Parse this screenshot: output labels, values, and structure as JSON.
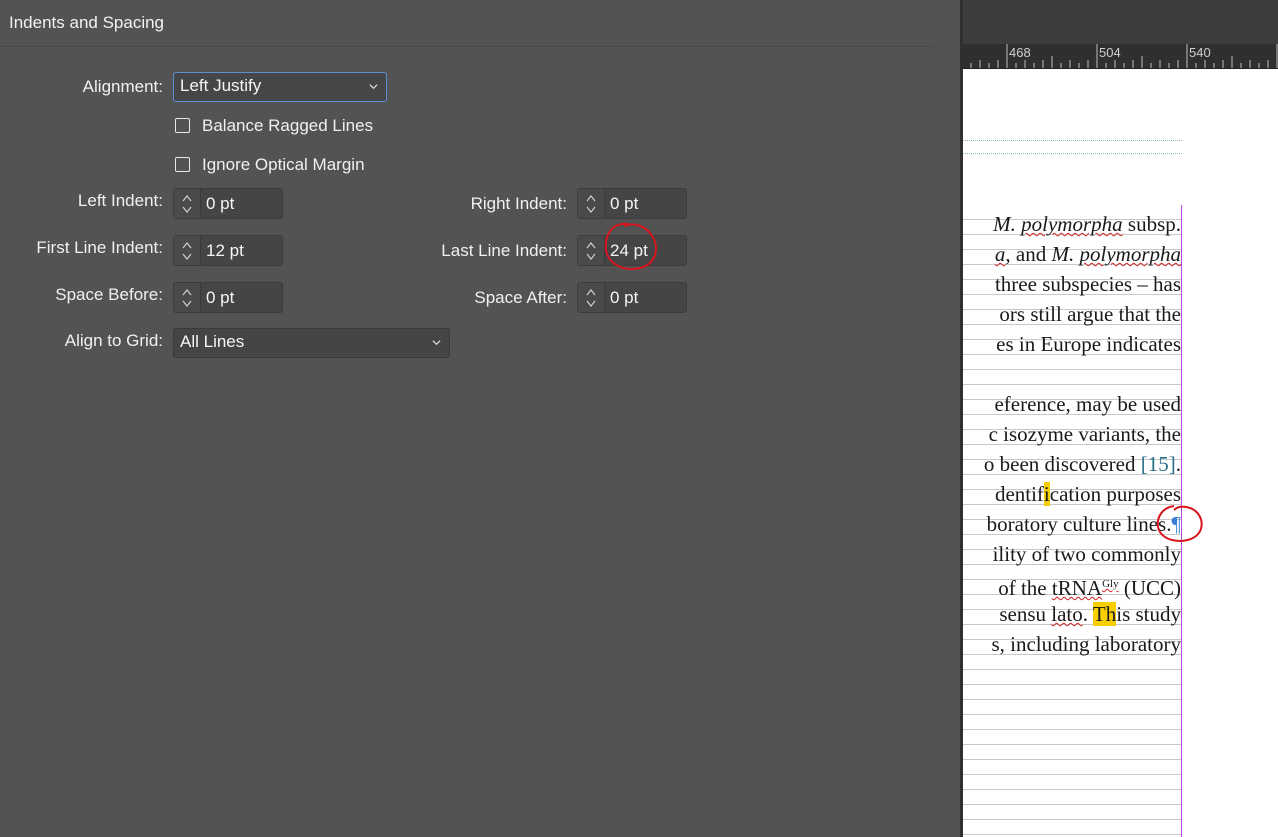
{
  "panel": {
    "title": "Indents and Spacing",
    "alignment_label": "Alignment:",
    "alignment_value": "Left Justify",
    "balance_ragged_label": "Balance Ragged Lines",
    "ignore_optical_label": "Ignore Optical Margin",
    "left_indent_label": "Left Indent:",
    "left_indent_value": "0 pt",
    "right_indent_label": "Right Indent:",
    "right_indent_value": "0 pt",
    "first_line_indent_label": "First Line Indent:",
    "first_line_indent_value": "12 pt",
    "last_line_indent_label": "Last Line Indent:",
    "last_line_indent_value": "24 pt",
    "space_before_label": "Space Before:",
    "space_before_value": "0 pt",
    "space_after_label": "Space After:",
    "space_after_value": "0 pt",
    "align_grid_label": "Align to Grid:",
    "align_grid_value": "All Lines"
  },
  "ruler": {
    "marks": [
      "468",
      "504",
      "540"
    ]
  },
  "document": {
    "lines": [
      {
        "pre": "",
        "it1": "M. ",
        "sq1": "polymorpha",
        "post": " subsp."
      },
      {
        "pre": "",
        "it1": "a",
        "post": ", and ",
        "it2": "M. ",
        "sq2": "polymorpha"
      },
      {
        "text": "three subspecies – has"
      },
      {
        "text": "ors still argue that the"
      },
      {
        "text": "es in Europe indicates"
      },
      {
        "text": "eference, may be used"
      },
      {
        "text": "c isozyme variants, the"
      },
      {
        "pre": "o been discovered ",
        "cite": "[15]",
        "post": "."
      },
      {
        "pre": "dentif",
        "hl": "i",
        "post": "cation purposes"
      },
      {
        "pre": "boratory culture lines.",
        "pil": "¶"
      },
      {
        "text": "ility of two commonly"
      },
      {
        "pre": "of the ",
        "sq": "tRNA",
        "sup": "Gly",
        "post": " (UCC)"
      },
      {
        "pre": "sensu ",
        "sq": "lato",
        "mid": ". ",
        "hl": "Th",
        "post": "is study"
      },
      {
        "text": "s, including laboratory"
      }
    ]
  },
  "colors": {
    "panel_bg": "#535353",
    "focus_border": "#5a8fd6",
    "annotation_circle": "#d8151e",
    "frame_border": "#b84bd6",
    "highlight": "#f7cf00"
  }
}
